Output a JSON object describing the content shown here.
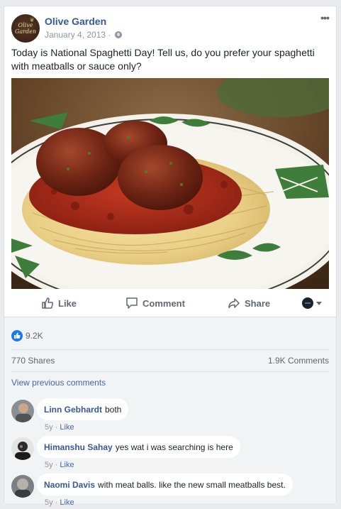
{
  "post": {
    "page_name": "Olive Garden",
    "date": "January 4, 2013",
    "meta_separator": " · ",
    "text": "Today is National Spaghetti Day! Tell us, do you prefer your spaghetti with meatballs or sauce only?",
    "avatar_text_line1": "Olive",
    "avatar_text_line2": "Garden",
    "more_label": "•••"
  },
  "actions": {
    "like": "Like",
    "comment": "Comment",
    "share": "Share"
  },
  "stats": {
    "reactions": "9.2K",
    "shares": "770 Shares",
    "comments": "1.9K Comments",
    "view_previous": "View previous comments"
  },
  "comments": [
    {
      "name": "Linn Gebhardt",
      "text": "both",
      "age": "5y",
      "like": "Like"
    },
    {
      "name": "Himanshu Sahay",
      "text": "yes wat i was searching is here",
      "age": "5y",
      "like": "Like"
    },
    {
      "name": "Naomi Davis",
      "text": "with meat balls. like the new small meatballs best.",
      "age": "5y",
      "like": "Like"
    }
  ],
  "colors": {
    "link": "#365899",
    "meta": "#90949c",
    "like_blue": "#1877f2",
    "plate_green": "#3f7d3a",
    "sauce_red": "#a3261a"
  },
  "icons": {
    "more": "more-icon",
    "globe": "globe-icon",
    "like": "thumbs-up-icon",
    "comment": "speech-bubble-icon",
    "share": "share-arrow-icon",
    "viewer": "profile-selector-icon",
    "reaction": "like-reaction-icon"
  }
}
